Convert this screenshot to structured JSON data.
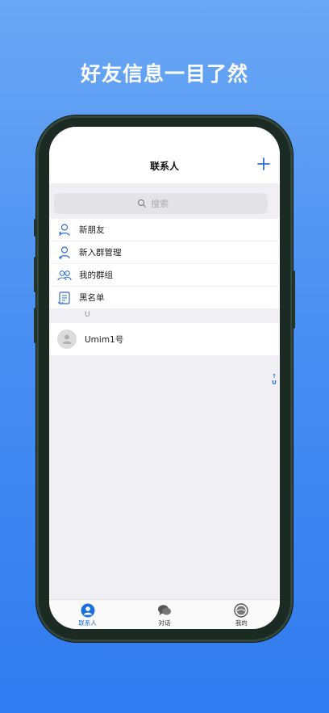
{
  "headline": "好友信息一目了然",
  "navbar": {
    "title": "联系人"
  },
  "search": {
    "placeholder": "搜索"
  },
  "menu": [
    {
      "label": "新朋友",
      "icon": "new-friend-icon"
    },
    {
      "label": "新入群管理",
      "icon": "group-join-icon"
    },
    {
      "label": "我的群组",
      "icon": "my-groups-icon"
    },
    {
      "label": "黑名单",
      "icon": "blacklist-icon"
    }
  ],
  "section_header": "U",
  "contacts": [
    {
      "name": "Umim1号"
    }
  ],
  "index_bar": {
    "arrow": "↑",
    "letter": "U"
  },
  "tabs": [
    {
      "label": "联系人",
      "icon": "contacts-icon",
      "active": true
    },
    {
      "label": "对话",
      "icon": "chat-icon",
      "active": false
    },
    {
      "label": "我的",
      "icon": "profile-icon",
      "active": false
    }
  ],
  "colors": {
    "accent": "#1b6fe0",
    "icon_blue": "#2f6fd8",
    "background": "#efeff4"
  }
}
